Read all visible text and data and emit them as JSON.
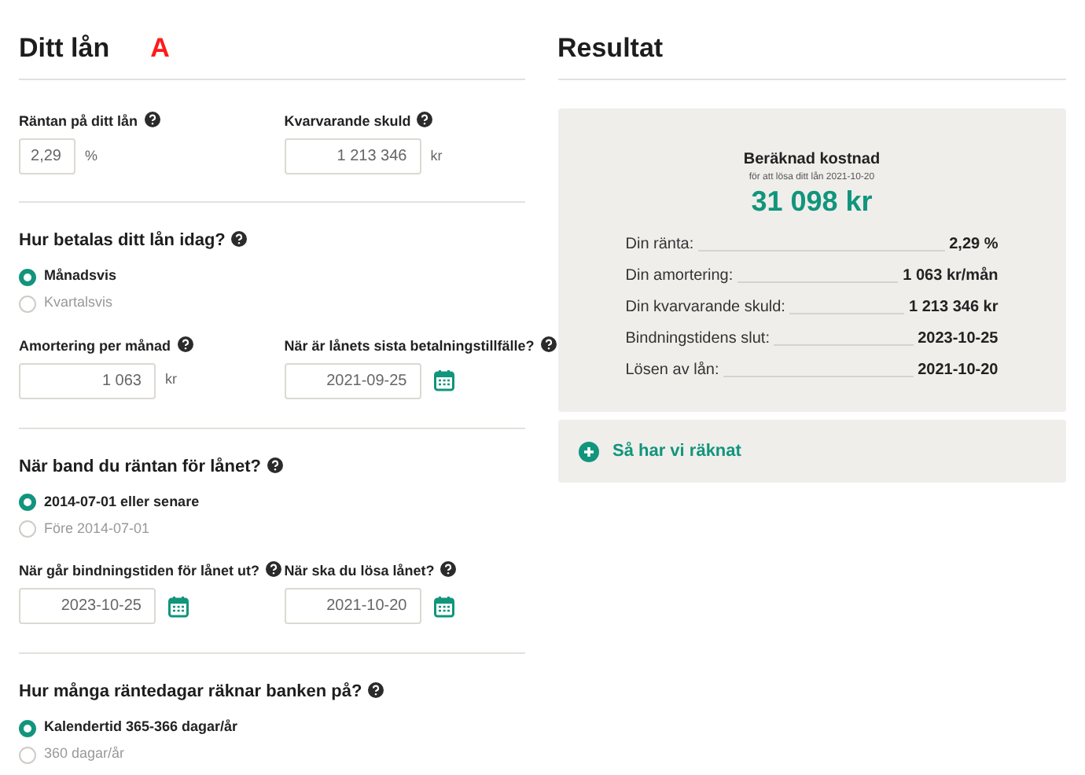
{
  "marker": "A",
  "left": {
    "title": "Ditt lån",
    "sections": [
      {
        "kind": "fields",
        "fields": [
          {
            "label": "Räntan på ditt lån",
            "value": "2,29",
            "unit": "%",
            "kind": "small"
          },
          {
            "label": "Kvarvarande skuld",
            "value": "1 213 346",
            "unit": "kr",
            "kind": "text"
          }
        ]
      },
      {
        "kind": "radios",
        "heading": "Hur betalas ditt lån idag?",
        "options": [
          {
            "label": "Månadsvis",
            "selected": true
          },
          {
            "label": "Kvartalsvis",
            "selected": false
          }
        ],
        "fields": [
          {
            "label": "Amortering per månad",
            "value": "1 063",
            "unit": "kr",
            "kind": "text"
          },
          {
            "label": "När är lånets sista betalningstillfälle?",
            "value": "2021-09-25",
            "kind": "date"
          }
        ]
      },
      {
        "kind": "radios",
        "heading": "När band du räntan för lånet?",
        "options": [
          {
            "label": "2014-07-01 eller senare",
            "selected": true
          },
          {
            "label": "Före 2014-07-01",
            "selected": false
          }
        ],
        "fields": [
          {
            "label": "När går bindningstiden för lånet ut?",
            "value": "2023-10-25",
            "kind": "date"
          },
          {
            "label": "När ska du lösa lånet?",
            "value": "2021-10-20",
            "kind": "date"
          }
        ]
      },
      {
        "kind": "radios",
        "heading": "Hur många räntedagar räknar banken på?",
        "options": [
          {
            "label": "Kalendertid 365-366 dagar/år",
            "selected": true
          },
          {
            "label": "360 dagar/år",
            "selected": false
          }
        ]
      }
    ]
  },
  "right": {
    "title": "Resultat",
    "result": {
      "heading": "Beräknad kostnad",
      "subheading": "för att lösa ditt lån 2021-10-20",
      "amount": "31 098 kr",
      "rows": [
        {
          "label": "Din ränta:",
          "value": "2,29 %"
        },
        {
          "label": "Din amortering:",
          "value": "1 063 kr/mån"
        },
        {
          "label": "Din kvarvarande skuld:",
          "value": "1 213 346 kr"
        },
        {
          "label": "Bindningstidens slut:",
          "value": "2023-10-25"
        },
        {
          "label": "Lösen av lån:",
          "value": "2021-10-20"
        }
      ]
    },
    "expander": {
      "label": "Så har vi räknat",
      "expanded": false
    }
  }
}
